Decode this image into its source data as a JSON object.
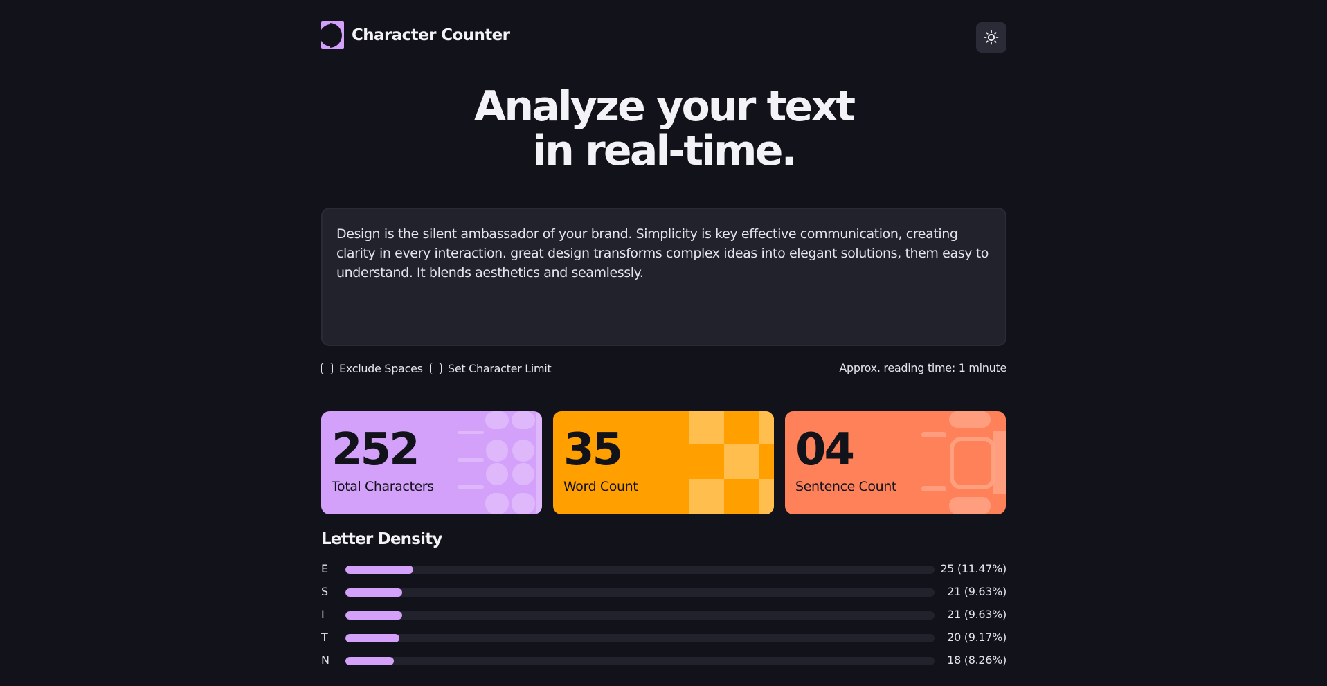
{
  "app": {
    "title": "Character Counter"
  },
  "hero": {
    "line1": "Analyze your text",
    "line2": "in real-time."
  },
  "textarea": {
    "value": "Design is the silent ambassador of your brand. Simplicity is key effective communication, creating clarity in every interaction. great design transforms complex ideas into elegant solutions, them easy to understand. It blends aesthetics and seamlessly."
  },
  "options": {
    "exclude_spaces": {
      "label": "Exclude Spaces",
      "checked": false
    },
    "char_limit": {
      "label": "Set Character Limit",
      "checked": false
    },
    "reading_time": "Approx. reading time: 1 minute"
  },
  "stats": [
    {
      "value": "252",
      "label": "Total Characters",
      "color": "#d3a0fa"
    },
    {
      "value": "35",
      "label": "Word Count",
      "color": "#ff9f00"
    },
    {
      "value": "04",
      "label": "Sentence Count",
      "color": "#fe8159"
    }
  ],
  "density": {
    "title": "Letter Density",
    "items": [
      {
        "letter": "E",
        "count": "25 (11.47%)",
        "percent": 11.47
      },
      {
        "letter": "S",
        "count": "21 (9.63%)",
        "percent": 9.63
      },
      {
        "letter": "I",
        "count": "21 (9.63%)",
        "percent": 9.63
      },
      {
        "letter": "T",
        "count": "20 (9.17%)",
        "percent": 9.17
      },
      {
        "letter": "N",
        "count": "18 (8.26%)",
        "percent": 8.26
      }
    ]
  },
  "icons": {
    "logo": "logo-mark-icon",
    "theme": "sun-icon"
  },
  "colors": {
    "background": "#12131a",
    "surface": "#21222c",
    "accent_purple": "#d3a0fa",
    "accent_orange": "#ff9f00",
    "accent_coral": "#fe8159"
  }
}
